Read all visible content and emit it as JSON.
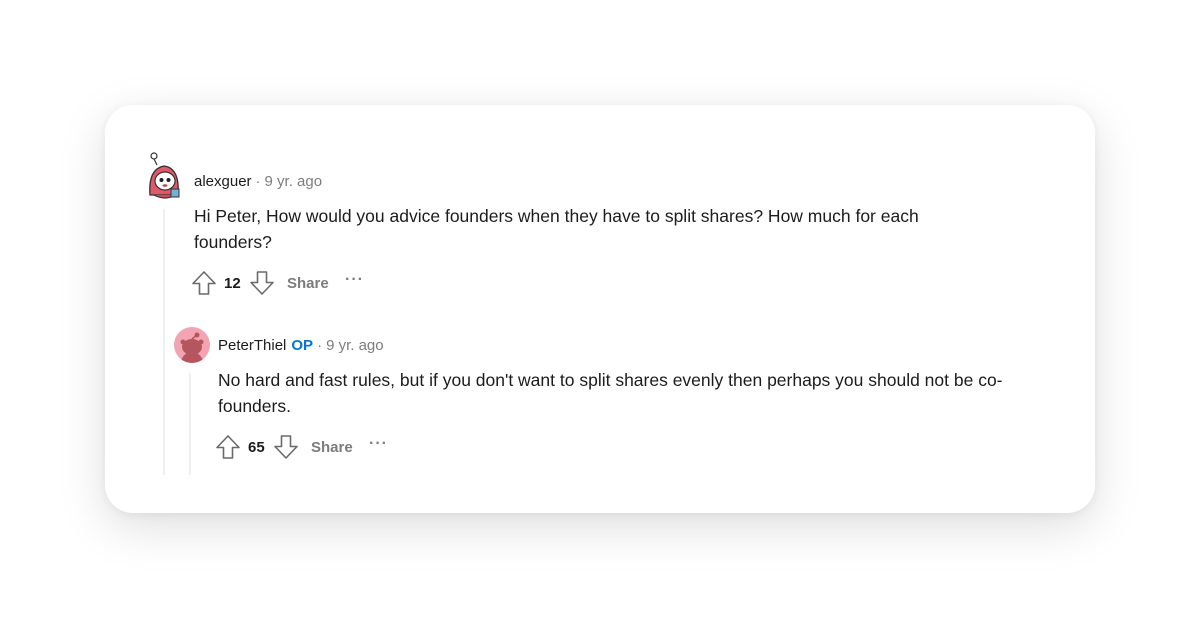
{
  "comments": [
    {
      "username": "alexguer",
      "time": "9 yr. ago",
      "body": "Hi Peter, How would you advice founders when they have to split shares? How much for each founders?",
      "score": "12",
      "share_label": "Share",
      "more_label": "···",
      "avatar_icon": "snoo-avatar-hooded-icon"
    },
    {
      "username": "PeterThiel",
      "badge": "OP",
      "time": "9 yr. ago",
      "body": "No hard and fast rules, but if you don't want to split shares evenly then perhaps you should not be co-founders.",
      "score": "65",
      "share_label": "Share",
      "more_label": "···",
      "avatar_icon": "snoo-default-avatar-icon"
    }
  ],
  "colors": {
    "op_badge": "#0079d3",
    "meta_gray": "#7c7c7c",
    "thread_line": "#edeff1",
    "default_avatar_bg": "#f2a4b2"
  }
}
